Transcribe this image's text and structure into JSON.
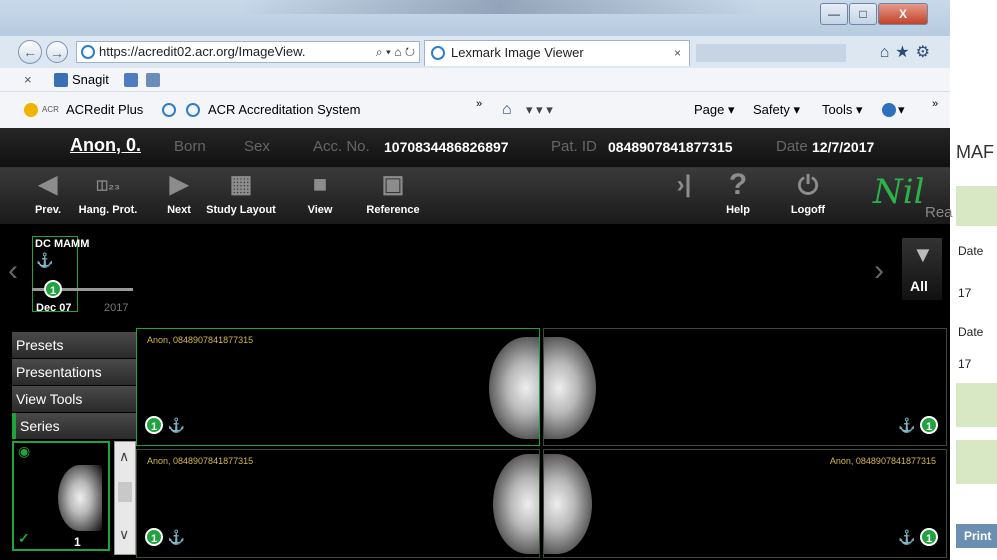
{
  "browser": {
    "url": "https://acredit02.acr.org/ImageView.",
    "url_tools": "⌕ ▾ ⌂ ↻",
    "tab_title": "Lexmark Image Viewer",
    "tab_close": "×",
    "win_min": "—",
    "win_max": "□",
    "win_close": "X",
    "nav_back": "←",
    "nav_forward": "→",
    "top_icons": "⌂★⚙",
    "snagit_close": "×",
    "snagit_label": "Snagit",
    "favorites": [
      "ACRedit Plus",
      "ACR Accreditation System"
    ],
    "fav_chevron": "»",
    "command_bar": [
      "Page ▾",
      "Safety ▾",
      "Tools ▾",
      "▾"
    ],
    "command_icons": "▾  ▾  ▾",
    "right_chevron": "»"
  },
  "patient": {
    "name": "Anon, 0.",
    "born_label": "Born",
    "sex_label": "Sex",
    "acc_label": "Acc. No.",
    "acc_no": "1070834486826897",
    "pat_id_label": "Pat. ID",
    "pat_id": "0848907841877315",
    "date_label": "Date",
    "date": "12/7/2017"
  },
  "toolbar": {
    "prev": "Prev.",
    "hang": "Hang. Prot.",
    "next": "Next",
    "study_layout": "Study Layout",
    "view": "View",
    "reference": "Reference",
    "help": "Help",
    "logoff": "Logoff",
    "brand": "Nil",
    "brand_sub": "Rea"
  },
  "timeline": {
    "study_label": "DC MAMM",
    "study_count": "1",
    "date_label": "Dec 07",
    "year_label": "2017",
    "filter_label": "All",
    "left_arrow": "‹",
    "right_arrow": "›"
  },
  "sidebar": {
    "items": [
      "Presets",
      "Presentations",
      "View Tools",
      "Series"
    ],
    "active": "Series",
    "thumb_count": "1",
    "scroll_up": "∧",
    "scroll_down": "∨"
  },
  "viewports": [
    {
      "label": "Anon, 0848907841877315",
      "badge": "1",
      "selected": true
    },
    {
      "label": "",
      "badge": "1",
      "selected": false
    },
    {
      "label": "Anon, 0848907841877315",
      "badge": "1",
      "selected": false
    },
    {
      "label": "Anon, 0848907841877315",
      "badge": "1",
      "selected": false
    }
  ],
  "background_page": {
    "title": "MAF",
    "labels": [
      "Date",
      "17",
      "Date",
      "17"
    ],
    "button": "Print"
  },
  "colors": {
    "accent_green": "#1fa33c",
    "viewer_bg": "#000000",
    "label_gold": "#d6b84a"
  }
}
